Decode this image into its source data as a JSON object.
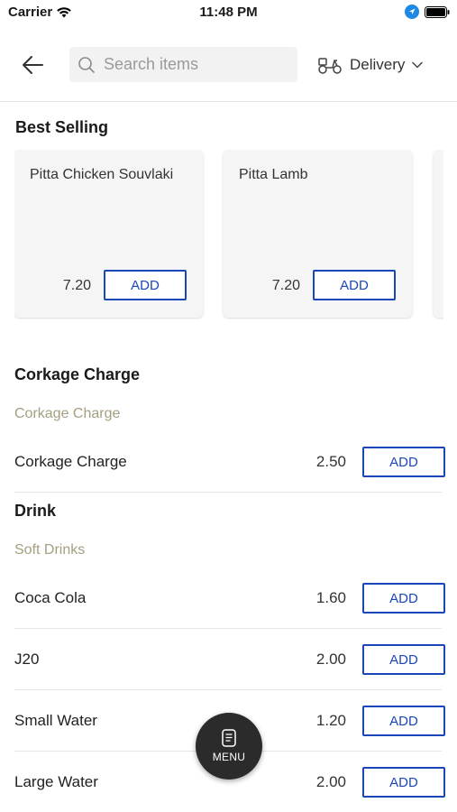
{
  "status_bar": {
    "carrier": "Carrier",
    "time": "11:48 PM"
  },
  "header": {
    "search_placeholder": "Search items",
    "delivery_label": "Delivery"
  },
  "best_selling": {
    "title": "Best Selling",
    "items": [
      {
        "name": "Pitta Chicken Souvlaki",
        "price": "7.20",
        "add_label": "ADD"
      },
      {
        "name": "Pitta Lamb",
        "price": "7.20",
        "add_label": "ADD"
      }
    ]
  },
  "categories": [
    {
      "title": "Corkage Charge",
      "subcategory": "Corkage Charge",
      "items": [
        {
          "name": "Corkage Charge",
          "price": "2.50",
          "add_label": "ADD"
        }
      ]
    },
    {
      "title": "Drink",
      "subcategory": "Soft Drinks",
      "items": [
        {
          "name": "Coca Cola",
          "price": "1.60",
          "add_label": "ADD"
        },
        {
          "name": "J20",
          "price": "2.00",
          "add_label": "ADD"
        },
        {
          "name": "Small Water",
          "price": "1.20",
          "add_label": "ADD"
        },
        {
          "name": "Large Water",
          "price": "2.00",
          "add_label": "ADD"
        }
      ]
    }
  ],
  "fab": {
    "label": "MENU"
  },
  "colors": {
    "accent": "#1a47b8",
    "subcategory": "#a59f80",
    "fab_bg": "#2b2b2b"
  }
}
